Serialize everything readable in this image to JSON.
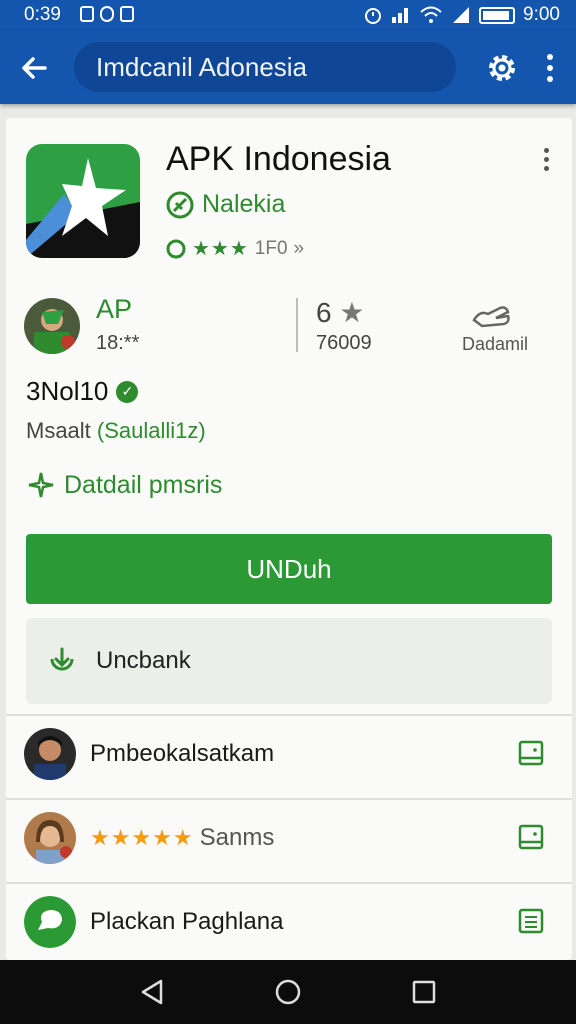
{
  "status_bar": {
    "time_left": "0:39",
    "time_right": "9:00"
  },
  "app_bar": {
    "search_text": "Imdcanil Adonesia"
  },
  "app": {
    "title": "APK Indonesia",
    "developer": "Nalekia",
    "rating_count": "1F0",
    "rating_suffix": "»"
  },
  "info": {
    "ap_title": "AP",
    "ap_sub": "18:**",
    "stat_num": "6",
    "stat_sub": "76009",
    "stat_label": "Dadamil"
  },
  "version": {
    "label": "3Nol10",
    "size_prefix": "Msaalt",
    "size_value": "(Saulalli1z)"
  },
  "details_link": "Datdail pmsris",
  "buttons": {
    "download": "UNDuh",
    "secondary": "Uncbank"
  },
  "list": [
    {
      "text": "Pmbeokalsatkam",
      "has_stars": false
    },
    {
      "text": "Sanms",
      "stars": "★★★★★",
      "has_stars": true
    },
    {
      "text": "Plackan Paghlana",
      "has_stars": false
    }
  ],
  "colors": {
    "primary_blue": "#1456ad",
    "green": "#2b9a35",
    "star_orange": "#f39c12"
  }
}
